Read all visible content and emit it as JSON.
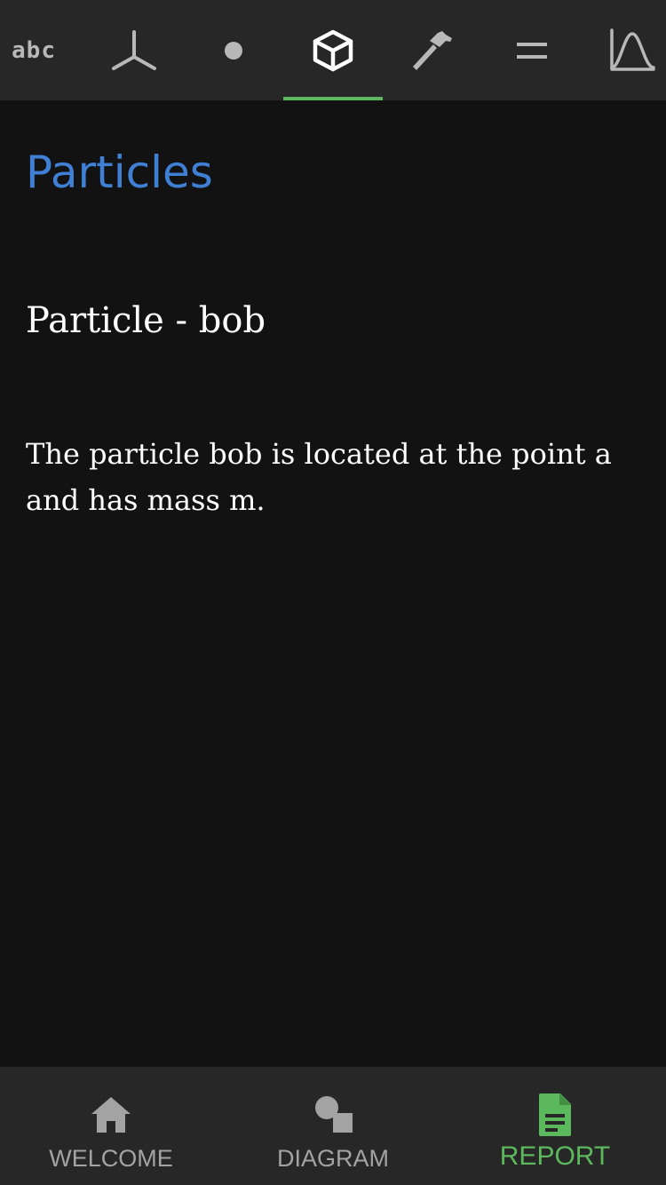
{
  "top_tabs": {
    "text_tab_label": "abc",
    "active_index": 3,
    "items": [
      {
        "icon": "text-icon"
      },
      {
        "icon": "axes-icon"
      },
      {
        "icon": "point-icon"
      },
      {
        "icon": "particle-cube-icon"
      },
      {
        "icon": "hammer-icon"
      },
      {
        "icon": "equals-icon"
      },
      {
        "icon": "curve-icon"
      }
    ]
  },
  "content": {
    "section_heading": "Particles",
    "item_title": "Particle - bob",
    "item_description": "The particle bob is located at the point a and has mass m."
  },
  "bottom_nav": {
    "active": "report",
    "items": [
      {
        "label": "WELCOME",
        "icon": "home-icon"
      },
      {
        "label": "DIAGRAM",
        "icon": "shapes-icon"
      },
      {
        "label": "REPORT",
        "icon": "document-icon"
      }
    ]
  },
  "colors": {
    "background": "#121212",
    "bar_background": "#272727",
    "accent_green": "#5cb85c",
    "heading_blue": "#3f7fd4",
    "icon_gray": "#b8b8b8",
    "icon_active": "#ffffff",
    "nav_label_gray": "#a3a3a3"
  }
}
